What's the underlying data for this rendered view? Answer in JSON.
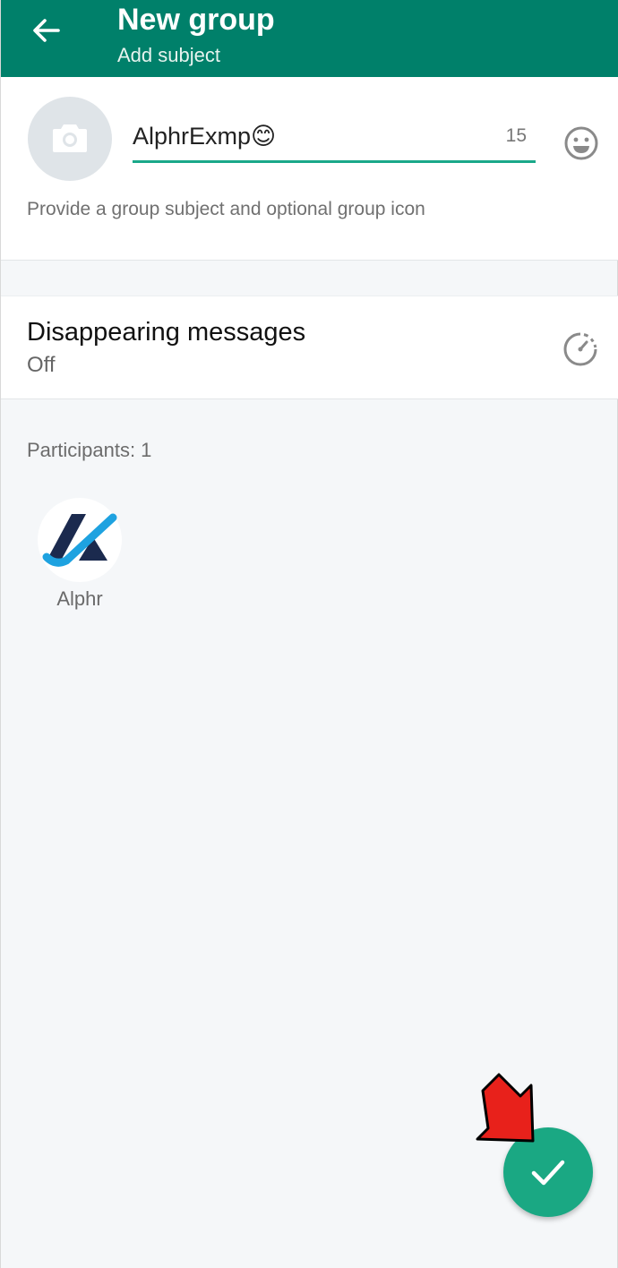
{
  "appbar": {
    "title": "New group",
    "subtitle": "Add subject",
    "back_icon": "arrow-left-icon",
    "color": "#00806a"
  },
  "subject": {
    "value": "AlphrExmp😊",
    "remaining": "15",
    "hint": "Provide a group subject and optional group icon",
    "photo_icon": "camera-icon",
    "emoji_icon": "emoji-icon",
    "underline_color": "#1aa889"
  },
  "disappearing": {
    "title": "Disappearing messages",
    "value": "Off",
    "icon": "timer-icon"
  },
  "participants": {
    "label": "Participants: 1",
    "items": [
      {
        "name": "Alphr",
        "avatar": "alphr-logo"
      }
    ]
  },
  "fab": {
    "icon": "checkmark-icon",
    "color": "#1aa883"
  },
  "annotation": {
    "icon": "red-arrow-pointer",
    "color": "#e8211b"
  }
}
